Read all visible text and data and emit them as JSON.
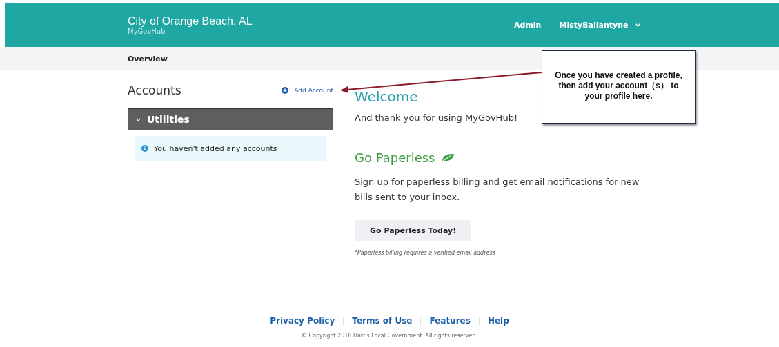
{
  "header": {
    "title": "City of Orange Beach, AL",
    "subtitle": "MyGovHub",
    "nav": [
      {
        "label": "Admin"
      }
    ],
    "user": {
      "name": "MistyBallantyne"
    }
  },
  "breadcrumb": "Overview",
  "accounts": {
    "title": "Accounts",
    "add_label": "Add Account",
    "groups": [
      {
        "label": "Utilities",
        "expanded": true,
        "empty_message": "You haven't added any accounts"
      }
    ]
  },
  "welcome": {
    "title": "Welcome",
    "text": "And thank you for using MyGovHub!"
  },
  "paperless": {
    "title": "Go Paperless",
    "text": "Sign up for paperless billing and get email notifications for new bills sent to your inbox.",
    "button": "Go Paperless Today!",
    "note": "*Paperless billing requires a verified email address"
  },
  "callout": {
    "text": "Once you have created a profile, then add your account（s） to your profile here."
  },
  "footer": {
    "links": [
      "Privacy Policy",
      "Terms of Use",
      "Features",
      "Help"
    ],
    "copyright": "© Copyright 2018 Harris Local Government. All rights reserved."
  }
}
